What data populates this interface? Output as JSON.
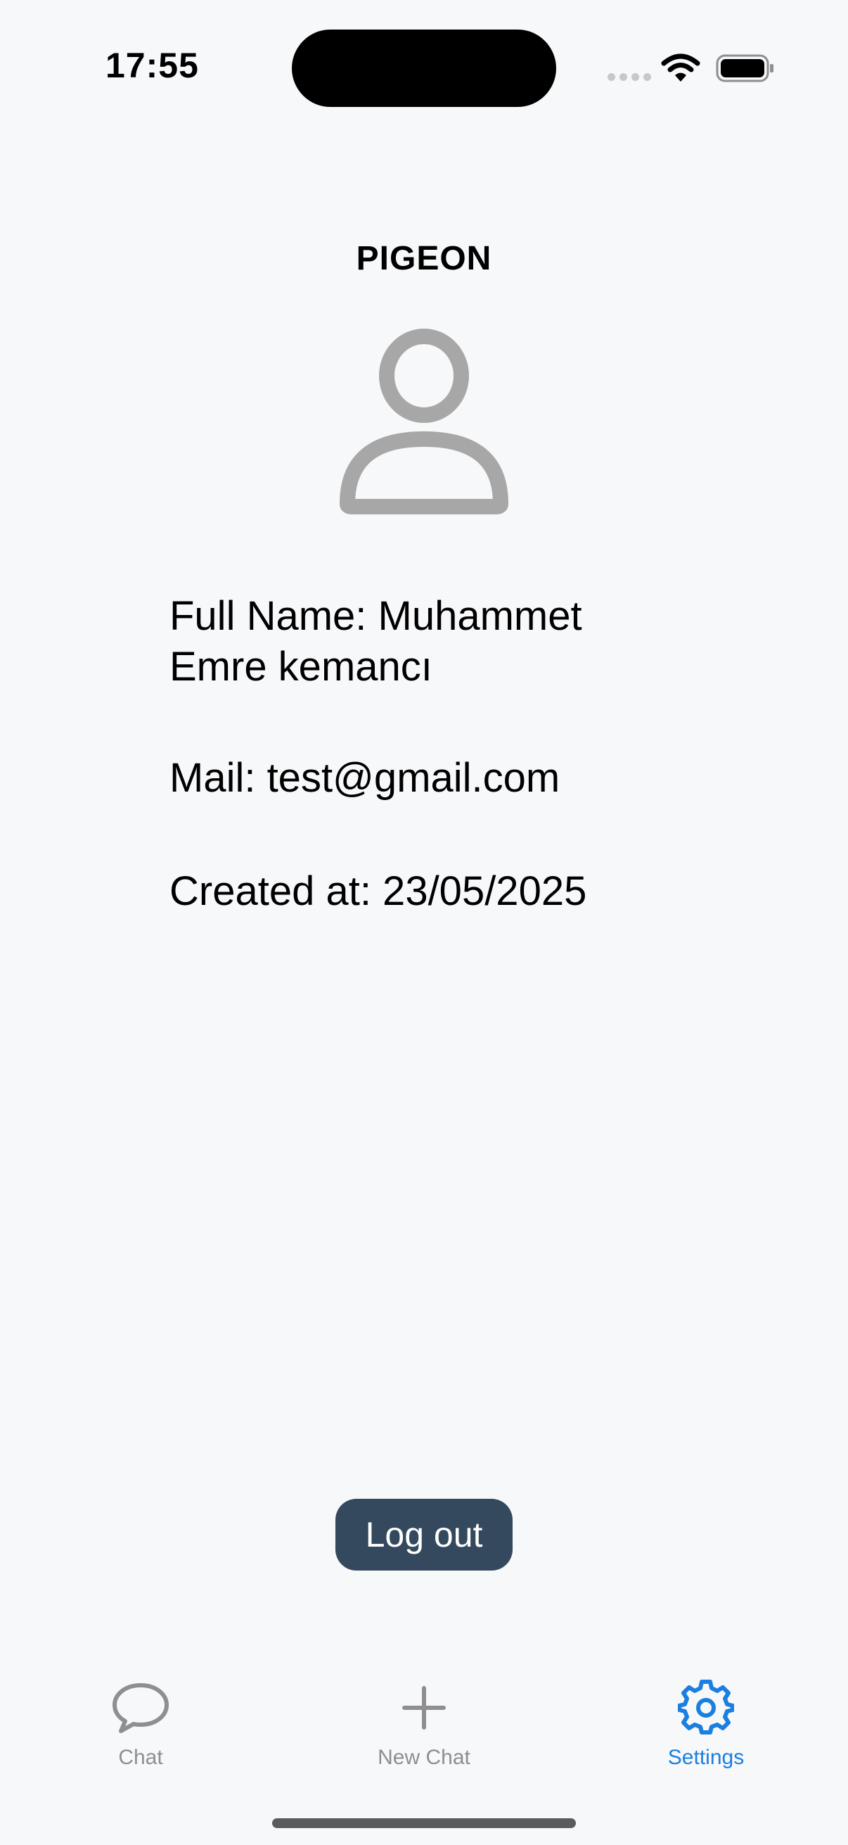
{
  "status_bar": {
    "time": "17:55"
  },
  "header": {
    "title": "PIGEON"
  },
  "profile": {
    "full_name_line": "Full Name: Muhammet Emre kemancı",
    "mail_line": "Mail: test@gmail.com",
    "created_line": "Created at: 23/05/2025"
  },
  "actions": {
    "logout_label": "Log out"
  },
  "tab_bar": {
    "items": [
      {
        "label": "Chat",
        "icon": "chat-bubble-icon"
      },
      {
        "label": "New Chat",
        "icon": "plus-icon"
      },
      {
        "label": "Settings",
        "icon": "gear-icon",
        "active": true
      }
    ]
  },
  "colors": {
    "background": "#f7f8fa",
    "button": "#34495e",
    "active_tab": "#1a7fe0",
    "inactive_tab": "#8e8e93",
    "avatar": "#a7a7a7"
  }
}
